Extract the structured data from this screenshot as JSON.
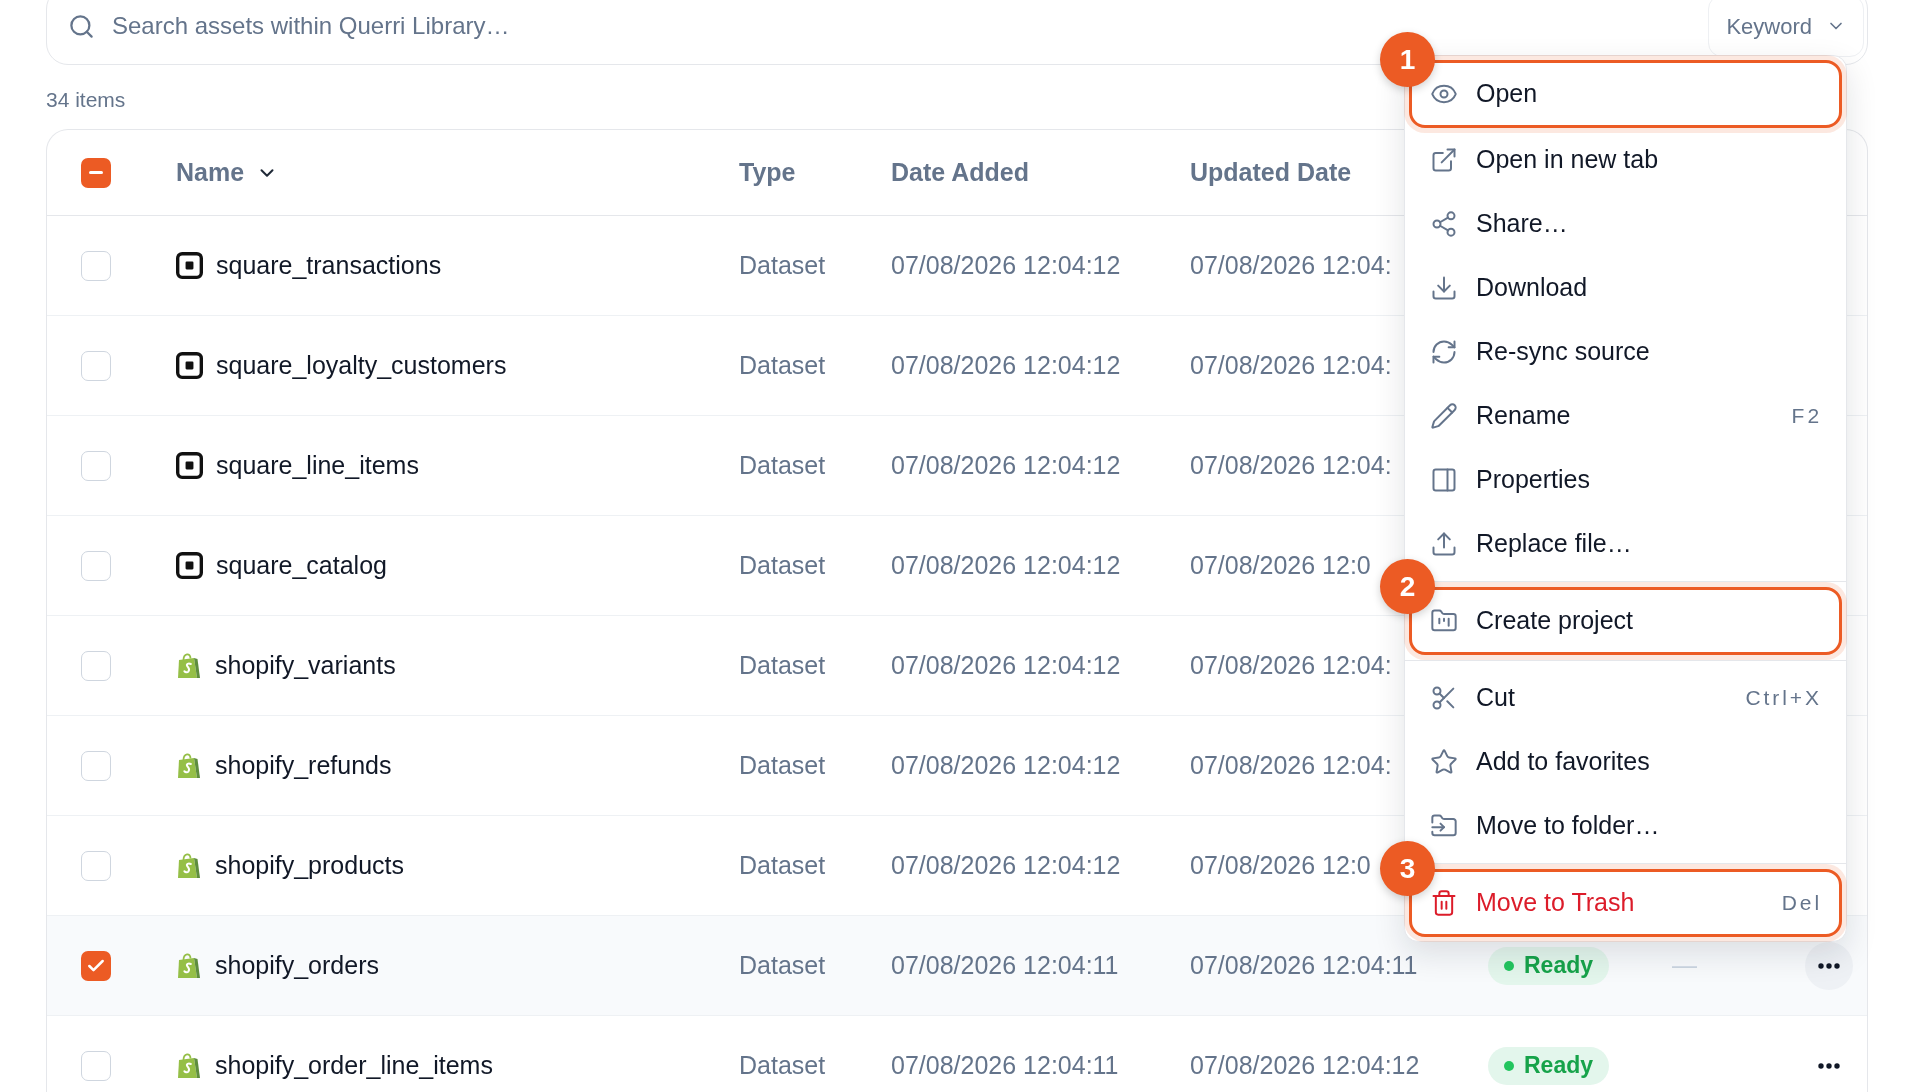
{
  "search": {
    "placeholder": "Search assets within Querri Library…",
    "mode_dropdown": {
      "label": "Keyword"
    }
  },
  "item_count": "34 items",
  "table": {
    "select_all": {
      "indeterminate": true
    },
    "columns": [
      {
        "label": "Name",
        "sorted": true
      },
      {
        "label": "Type",
        "sorted": false
      },
      {
        "label": "Date Added",
        "sorted": false
      },
      {
        "label": "Updated Date",
        "sorted": false
      }
    ],
    "rows": [
      {
        "kind": "square",
        "name": "square_transactions",
        "type": "Dataset",
        "date_added": "07/08/2026 12:04:12",
        "updated_date": "07/08/2026 12:04:",
        "selected": false
      },
      {
        "kind": "square",
        "name": "square_loyalty_customers",
        "type": "Dataset",
        "date_added": "07/08/2026 12:04:12",
        "updated_date": "07/08/2026 12:04:",
        "selected": false
      },
      {
        "kind": "square",
        "name": "square_line_items",
        "type": "Dataset",
        "date_added": "07/08/2026 12:04:12",
        "updated_date": "07/08/2026 12:04:",
        "selected": false
      },
      {
        "kind": "square",
        "name": "square_catalog",
        "type": "Dataset",
        "date_added": "07/08/2026 12:04:12",
        "updated_date": "07/08/2026 12:0",
        "selected": false
      },
      {
        "kind": "shopify",
        "name": "shopify_variants",
        "type": "Dataset",
        "date_added": "07/08/2026 12:04:12",
        "updated_date": "07/08/2026 12:04:",
        "selected": false
      },
      {
        "kind": "shopify",
        "name": "shopify_refunds",
        "type": "Dataset",
        "date_added": "07/08/2026 12:04:12",
        "updated_date": "07/08/2026 12:04:",
        "selected": false
      },
      {
        "kind": "shopify",
        "name": "shopify_products",
        "type": "Dataset",
        "date_added": "07/08/2026 12:04:12",
        "updated_date": "07/08/2026 12:0",
        "selected": false
      },
      {
        "kind": "shopify",
        "name": "shopify_orders",
        "type": "Dataset",
        "date_added": "07/08/2026 12:04:11",
        "updated_date": "07/08/2026 12:04:11",
        "status": "Ready",
        "column_7": "—",
        "menu_open": true,
        "selected": true
      },
      {
        "kind": "shopify",
        "name": "shopify_order_line_items",
        "type": "Dataset",
        "date_added": "07/08/2026 12:04:11",
        "updated_date": "07/08/2026 12:04:12",
        "status": "Ready",
        "menu_open": false,
        "selected": false
      }
    ]
  },
  "context_menu": {
    "groups": [
      [
        {
          "label": "Open",
          "highlighted": true,
          "callout": "1",
          "destructive": false
        },
        {
          "label": "Open in new tab",
          "highlighted": false,
          "destructive": false
        },
        {
          "label": "Share…",
          "highlighted": false,
          "destructive": false
        },
        {
          "label": "Download",
          "highlighted": false,
          "destructive": false
        },
        {
          "label": "Re-sync source",
          "highlighted": false,
          "destructive": false
        },
        {
          "label": "Rename",
          "shortcut": "F2",
          "highlighted": false,
          "destructive": false
        },
        {
          "label": "Properties",
          "highlighted": false,
          "destructive": false
        },
        {
          "label": "Replace file…",
          "highlighted": false,
          "destructive": false
        }
      ],
      [
        {
          "label": "Create project",
          "highlighted": true,
          "callout": "2",
          "destructive": false
        }
      ],
      [
        {
          "label": "Cut",
          "shortcut": "Ctrl+X",
          "highlighted": false,
          "destructive": false
        },
        {
          "label": "Add to favorites",
          "highlighted": false,
          "destructive": false
        },
        {
          "label": "Move to folder…",
          "highlighted": false,
          "destructive": false
        }
      ],
      [
        {
          "label": "Move to Trash",
          "shortcut": "Del",
          "highlighted": true,
          "callout": "3",
          "destructive": true
        }
      ]
    ]
  }
}
